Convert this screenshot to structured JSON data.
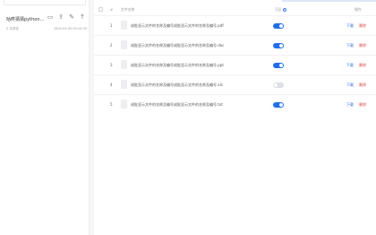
{
  "sidebar": {
    "course_title": "咕咚猜猜python…",
    "meta_left": "5 次浏览",
    "meta_right": "2020-09-09 09:10:33",
    "tools": [
      {
        "icon": "folder-icon",
        "glyph": "▭"
      },
      {
        "icon": "upload-icon",
        "glyph": "⇪"
      },
      {
        "icon": "edit-icon",
        "glyph": "✎"
      },
      {
        "icon": "arrow-up-icon",
        "glyph": "↑"
      }
    ]
  },
  "table": {
    "headers": {
      "index": "#",
      "name": "文件名称",
      "visible": "可见",
      "operations": "操作"
    },
    "rows": [
      {
        "index": "1",
        "name": "成批显示文件的名称及编号成批显示文件的名称及编号.pdf",
        "visible": true,
        "download": "下载",
        "delete": "删除"
      },
      {
        "index": "2",
        "name": "成批显示文件的名称及编号成批显示文件的名称及编号.doc",
        "visible": true,
        "download": "下载",
        "delete": "删除"
      },
      {
        "index": "3",
        "name": "成批显示文件的名称及编号成批显示文件的名称及编号.ppt",
        "visible": true,
        "download": "下载",
        "delete": "删除"
      },
      {
        "index": "4",
        "name": "成批显示文件的名称及编号成批显示文件的名称及编号.xls",
        "visible": false,
        "download": "下载",
        "delete": "删除"
      },
      {
        "index": "5",
        "name": "成批显示文件的名称及编号成批显示文件的名称及编号.txt",
        "visible": true,
        "download": "下载",
        "delete": "删除"
      }
    ]
  },
  "colors": {
    "accent": "#1b6ef3",
    "danger": "#e5443b",
    "toggle_off": "#dcdfe5"
  }
}
